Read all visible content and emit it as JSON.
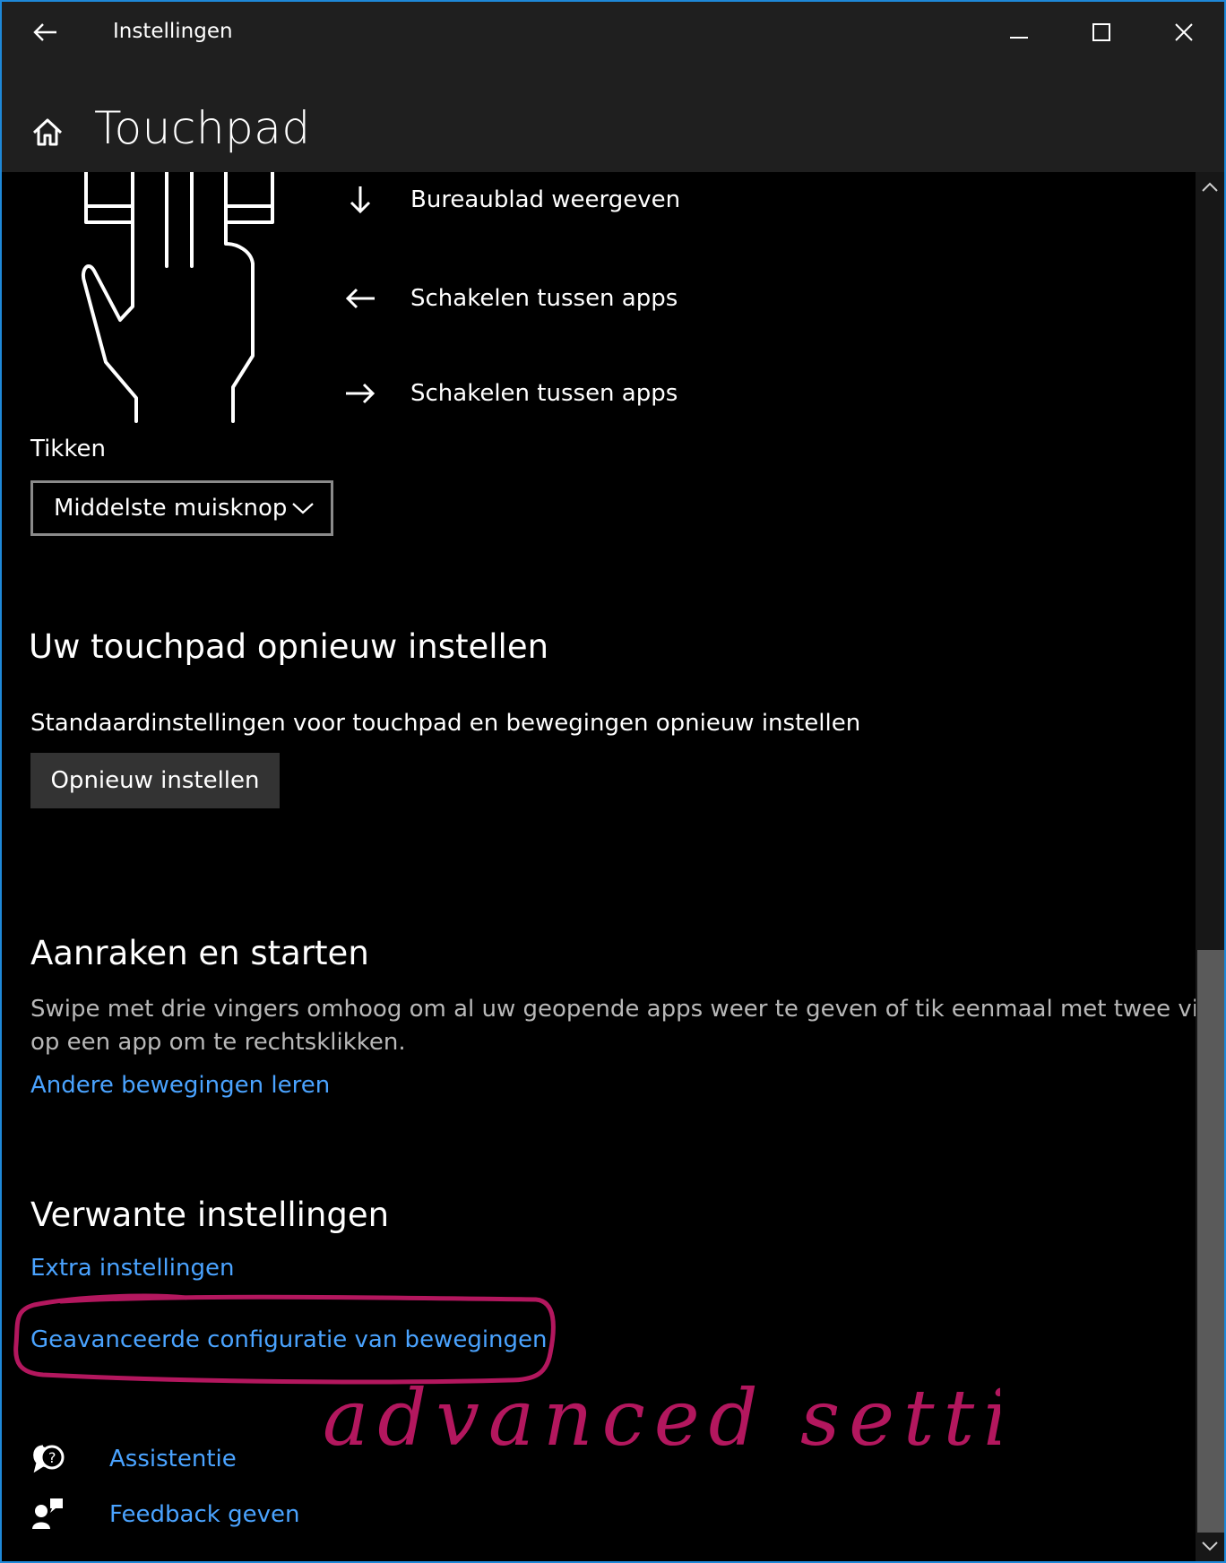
{
  "window": {
    "app_title": "Instellingen",
    "page_title": "Touchpad",
    "accent_color": "#1e88d8"
  },
  "gestures": [
    {
      "direction": "down",
      "icon": "arrow-down-icon",
      "label": "Bureaublad weergeven"
    },
    {
      "direction": "left",
      "icon": "arrow-left-icon",
      "label": "Schakelen tussen apps"
    },
    {
      "direction": "right",
      "icon": "arrow-right-icon",
      "label": "Schakelen tussen apps"
    }
  ],
  "tap": {
    "label": "Tikken",
    "selected": "Middelste muisknop"
  },
  "reset": {
    "title": "Uw touchpad opnieuw instellen",
    "description": "Standaardinstellingen voor touchpad en bewegingen opnieuw instellen",
    "button_label": "Opnieuw instellen"
  },
  "touch": {
    "title": "Aanraken en starten",
    "description_line1": "Swipe met drie vingers omhoog om al uw geopende apps weer te geven of tik eenmaal met twee vingers",
    "description_line2": "op een app om te rechtsklikken.",
    "link": "Andere bewegingen leren"
  },
  "related": {
    "title": "Verwante instellingen",
    "links": [
      "Extra instellingen",
      "Geavanceerde configuratie van bewegingen"
    ]
  },
  "footer": {
    "help_label": "Assistentie",
    "feedback_label": "Feedback geven"
  },
  "annotation": {
    "text": "advanced settings",
    "color": "#b3175e"
  },
  "colors": {
    "link": "#4aa3ff",
    "titlebar": "#1f1f1f",
    "button": "#333333"
  }
}
